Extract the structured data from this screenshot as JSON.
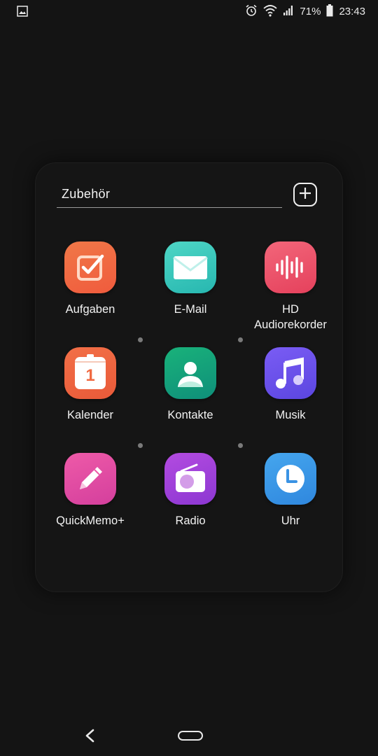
{
  "status_bar": {
    "battery_percent": "71%",
    "time": "23:43",
    "icons": [
      "image-notification-icon",
      "alarm-icon",
      "wifi-icon",
      "signal-icon",
      "battery-icon"
    ]
  },
  "folder": {
    "title": "Zubehör",
    "add_button_icon": "plus-icon",
    "apps": [
      {
        "label": "Aufgaben",
        "icon": "task-check-icon",
        "colors": [
          "#f07848",
          "#f05b3d"
        ]
      },
      {
        "label": "E-Mail",
        "icon": "envelope-icon",
        "colors": [
          "#4ed6c5",
          "#27b7b0"
        ]
      },
      {
        "label": "HD Audiorekorder",
        "icon": "sound-wave-icon",
        "colors": [
          "#f2667a",
          "#e5415c"
        ]
      },
      {
        "label": "Kalender",
        "icon": "calendar-icon",
        "day": "1",
        "colors": [
          "#f26f47",
          "#e95a39"
        ]
      },
      {
        "label": "Kontakte",
        "icon": "person-icon",
        "colors": [
          "#19b27a",
          "#0f8f7a"
        ]
      },
      {
        "label": "Musik",
        "icon": "music-note-icon",
        "colors": [
          "#7a5cf4",
          "#5b46e0"
        ]
      },
      {
        "label": "QuickMemo+",
        "icon": "pencil-icon",
        "colors": [
          "#ee5aa8",
          "#d43f9d"
        ]
      },
      {
        "label": "Radio",
        "icon": "radio-icon",
        "colors": [
          "#b34be0",
          "#8c37d2"
        ]
      },
      {
        "label": "Uhr",
        "icon": "clock-icon",
        "colors": [
          "#45a6ee",
          "#2f87de"
        ]
      }
    ]
  },
  "nav_bar": {
    "back_icon": "back-chevron-icon",
    "home_icon": "home-pill-icon"
  }
}
